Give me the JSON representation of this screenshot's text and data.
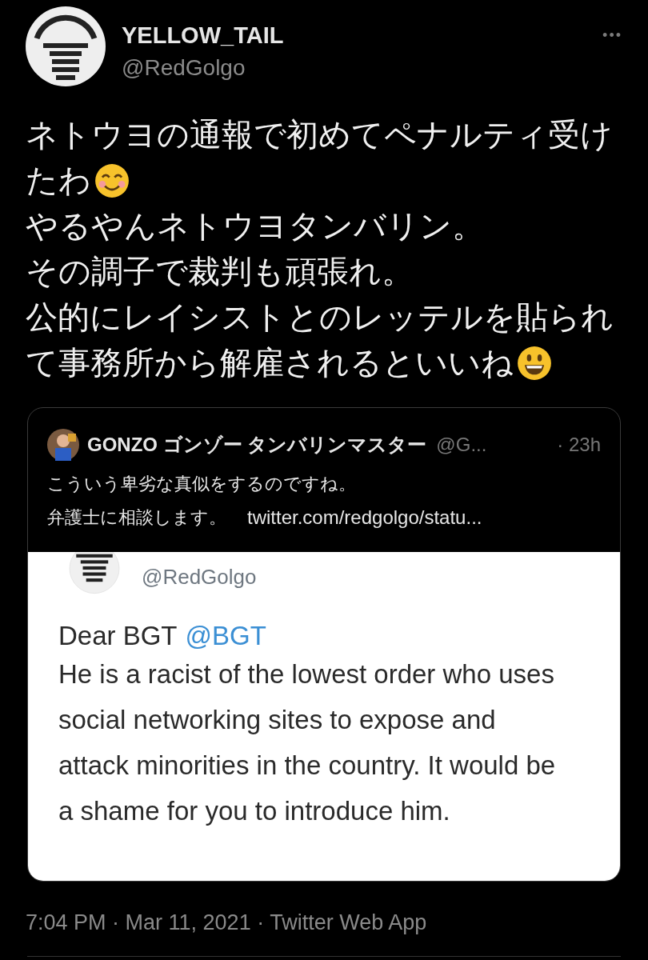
{
  "tweet": {
    "author": {
      "name": "YELLOW_TAIL",
      "handle": "@RedGolgo"
    },
    "more": "•••",
    "body": [
      {
        "text": "ネトウヨの通報で初めてペナルティ受け"
      },
      {
        "text": "たわ",
        "kind": "smiling"
      },
      {
        "text": "やるやんネトウヨタンバリン。"
      },
      {
        "text": "その調子で裁判も頑張れ。"
      },
      {
        "text": "公的にレイシストとのレッテルを貼られ"
      },
      {
        "text": "て事務所から解雇されるといいね",
        "kind": "grinning"
      }
    ],
    "quote": {
      "name": "GONZO ゴンゾー タンバリンマスター",
      "handle": "@G...",
      "time": "· 23h",
      "lines": [
        "こういう卑劣な真似をするのですね。",
        "弁護士に相談します。"
      ],
      "link": "twitter.com/redgolgo/statu...",
      "screenshot": {
        "handle": "@RedGolgo",
        "greeting": "Dear BGT",
        "mention": "@BGT",
        "text": "He is a racist of the lowest order who uses social networking sites to expose and attack minorities in the country. It would be a shame for you to introduce him."
      }
    },
    "meta": "7:04 PM · Mar 11, 2021 · Twitter Web App"
  }
}
